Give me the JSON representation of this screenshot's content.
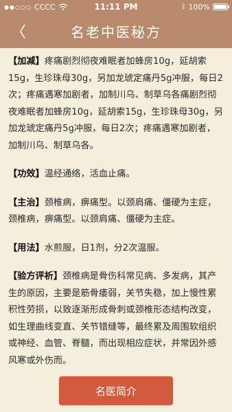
{
  "status": {
    "carrier": "CCCC",
    "time": "11:11 PM",
    "battery": "100%",
    "battery_level": 1.0
  },
  "nav": {
    "title": "名老中医秘方",
    "back_glyph": "〈"
  },
  "sections": [
    {
      "tag": "【加减】",
      "text": "疼痛剧烈彻夜难眠者加蜂房10g，延胡索15g，生珍珠母30g，另加龙琥定痛丹5g冲服，每日2次；疼痛遇寒加剧者，加制川乌、制草乌各痛剧烈彻夜难眠者加蜂房10g，延胡索15g，生珍珠母30g，另加龙琥定痛丹5g冲服，每日2次；疼痛遇寒加剧者，加制川乌、制草乌各。"
    },
    {
      "tag": "【功效】",
      "text": "温经通络，活血止痛。"
    },
    {
      "tag": "【主治】",
      "text": "颈椎病，痹痛型。以颈肩痛、僵硬为主症，颈椎病，痹痛型。以颈肩痛、僵硬为主症。"
    },
    {
      "tag": "【用法】",
      "text": "水煎服，日1剂，分2次温服。"
    },
    {
      "tag": "【验方评析】",
      "text": "颈椎病是骨伤科常见病、多发病，其产生的原因，主要是筋骨痿弱，关节失稳，加上慢性累积性劳损，以致逐渐形成骨刺或颈椎形态结构改变，如生理曲线变直、关节错缝等，最终累及周围软组织或神经、血管、脊髓，而出现相应症状，并常因外感风寒或外伤而。"
    }
  ],
  "footer": {
    "button_label": "名医简介"
  }
}
